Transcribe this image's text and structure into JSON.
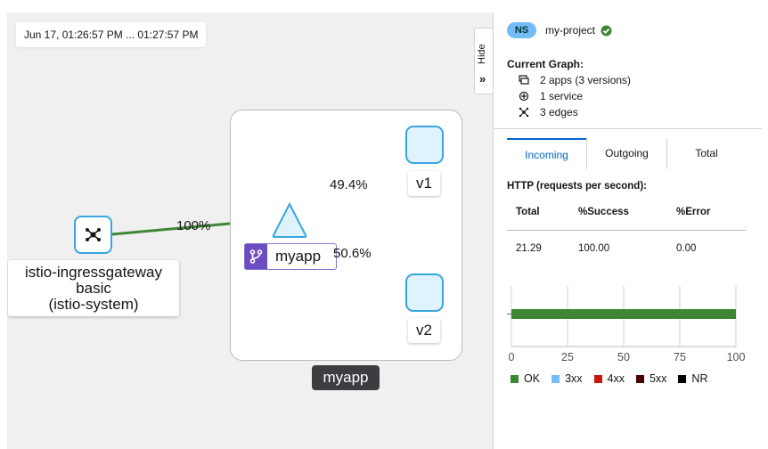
{
  "graph": {
    "time_range": "Jun 17, 01:26:57 PM ... 01:27:57 PM",
    "hide_label": "Hide",
    "nodes": {
      "ingress": {
        "line1": "istio-ingressgateway",
        "line2": "basic",
        "line3": "(istio-system)"
      },
      "service": {
        "label": "myapp"
      },
      "v1": {
        "label": "v1"
      },
      "v2": {
        "label": "v2"
      },
      "app_box": {
        "label": "myapp"
      }
    },
    "edges": [
      {
        "label": "100%"
      },
      {
        "label": "49.4%"
      },
      {
        "label": "50.6%"
      }
    ],
    "colors": {
      "edge": "#3e8635",
      "node_border": "#39a5dc",
      "node_fill": "#def3ff",
      "service_badge": "#6e4dc4"
    }
  },
  "panel": {
    "namespace_badge": "NS",
    "namespace": "my-project",
    "current_graph_title": "Current Graph:",
    "apps": "2 apps (3 versions)",
    "services": "1 service",
    "edges": "3 edges",
    "tabs": [
      "Incoming",
      "Outgoing",
      "Total"
    ],
    "active_tab": "Incoming",
    "http_title": "HTTP (requests per second):",
    "table": {
      "headers": [
        "Total",
        "%Success",
        "%Error"
      ],
      "rows": [
        [
          "21.29",
          "100.00",
          "0.00"
        ]
      ]
    }
  },
  "chart_data": {
    "type": "bar",
    "orientation": "horizontal",
    "stacked": true,
    "categories": [
      ""
    ],
    "series": [
      {
        "name": "OK",
        "values": [
          100
        ],
        "color": "#3e8635"
      },
      {
        "name": "3xx",
        "values": [
          0
        ],
        "color": "#73bcf7"
      },
      {
        "name": "4xx",
        "values": [
          0
        ],
        "color": "#c9190b"
      },
      {
        "name": "5xx",
        "values": [
          0
        ],
        "color": "#470000"
      },
      {
        "name": "NR",
        "values": [
          0
        ],
        "color": "#000000"
      }
    ],
    "xticks": [
      0,
      25,
      50,
      75,
      100
    ],
    "xlim": [
      0,
      100
    ],
    "grid": true,
    "legend": "bottom"
  }
}
